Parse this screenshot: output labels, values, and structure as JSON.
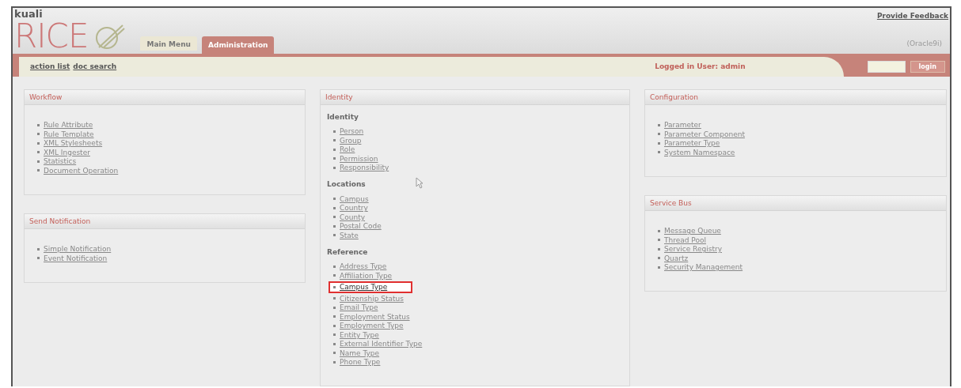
{
  "logo": {
    "top": "kuali",
    "main": "RICE"
  },
  "header": {
    "feedback_link": "Provide Feedback",
    "database": "(Oracle9i)"
  },
  "tabs": [
    {
      "label": "Main Menu",
      "selected": false
    },
    {
      "label": "Administration",
      "selected": true
    }
  ],
  "nav": {
    "links": [
      "action list",
      "doc search"
    ],
    "logged_in": "Logged in User: admin",
    "login_button": "login"
  },
  "columns": [
    [
      {
        "title": "Workflow",
        "groups": [
          {
            "items": [
              {
                "label": "Rule Attribute",
                "highlighted": false
              },
              {
                "label": "Rule Template",
                "highlighted": false
              },
              {
                "label": "XML Stylesheets",
                "highlighted": false
              },
              {
                "label": "XML Ingester",
                "highlighted": false
              },
              {
                "label": "Statistics",
                "highlighted": false
              },
              {
                "label": "Document Operation",
                "highlighted": false
              }
            ]
          }
        ]
      },
      {
        "title": "Send Notification",
        "groups": [
          {
            "items": [
              {
                "label": "Simple Notification",
                "highlighted": false
              },
              {
                "label": "Event Notification",
                "highlighted": false
              }
            ]
          }
        ]
      }
    ],
    [
      {
        "title": "Identity",
        "groups": [
          {
            "heading": "Identity",
            "items": [
              {
                "label": "Person",
                "highlighted": false
              },
              {
                "label": "Group",
                "highlighted": false
              },
              {
                "label": "Role",
                "highlighted": false
              },
              {
                "label": "Permission",
                "highlighted": false
              },
              {
                "label": "Responsibility",
                "highlighted": false
              }
            ]
          },
          {
            "heading": "Locations",
            "items": [
              {
                "label": "Campus",
                "highlighted": false
              },
              {
                "label": "Country",
                "highlighted": false
              },
              {
                "label": "County",
                "highlighted": false
              },
              {
                "label": "Postal Code",
                "highlighted": false
              },
              {
                "label": "State",
                "highlighted": false
              }
            ]
          },
          {
            "heading": "Reference",
            "items": [
              {
                "label": "Address Type",
                "highlighted": false
              },
              {
                "label": "Affiliation Type",
                "highlighted": false
              },
              {
                "label": "Campus Type",
                "highlighted": true
              },
              {
                "label": "Citizenship Status",
                "highlighted": false
              },
              {
                "label": "Email Type",
                "highlighted": false
              },
              {
                "label": "Employment Status",
                "highlighted": false
              },
              {
                "label": "Employment Type",
                "highlighted": false
              },
              {
                "label": "Entity Type",
                "highlighted": false
              },
              {
                "label": "External Identifier Type",
                "highlighted": false
              },
              {
                "label": "Name Type",
                "highlighted": false
              },
              {
                "label": "Phone Type",
                "highlighted": false
              }
            ]
          }
        ]
      }
    ],
    [
      {
        "title": "Configuration",
        "groups": [
          {
            "items": [
              {
                "label": "Parameter",
                "highlighted": false
              },
              {
                "label": "Parameter Component",
                "highlighted": false
              },
              {
                "label": "Parameter Type",
                "highlighted": false
              },
              {
                "label": "System Namespace",
                "highlighted": false
              }
            ]
          }
        ]
      },
      {
        "title": "Service Bus",
        "groups": [
          {
            "items": [
              {
                "label": "Message Queue",
                "highlighted": false
              },
              {
                "label": "Thread Pool",
                "highlighted": false
              },
              {
                "label": "Service Registry",
                "highlighted": false
              },
              {
                "label": "Quartz",
                "highlighted": false
              },
              {
                "label": "Security Management",
                "highlighted": false
              }
            ]
          }
        ]
      }
    ]
  ]
}
